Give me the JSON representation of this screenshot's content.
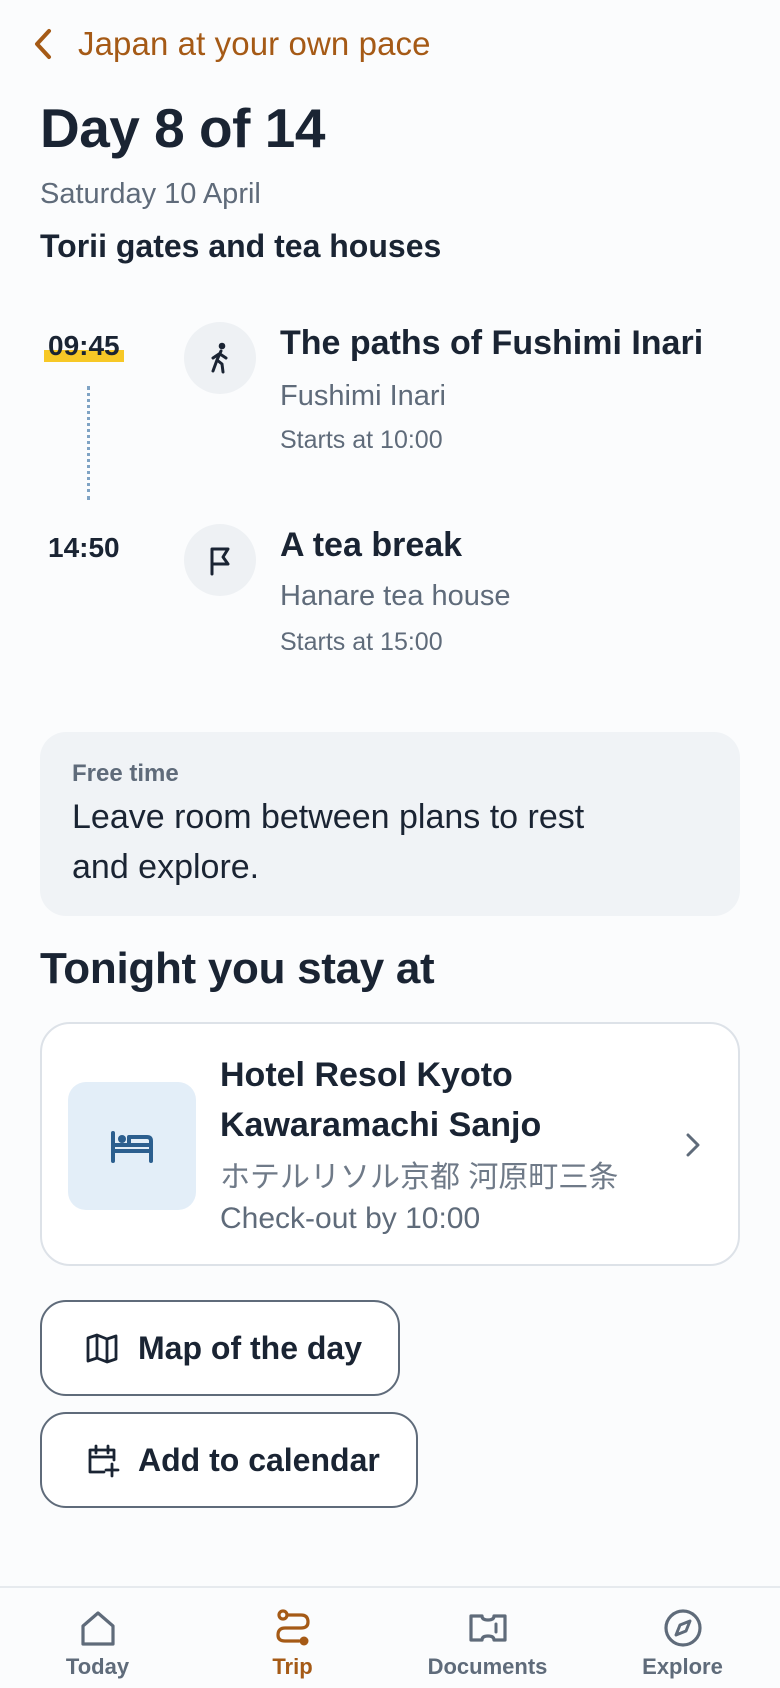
{
  "header": {
    "back_label": "Japan at your own pace",
    "day_title": "Day 8 of 14",
    "date": "Saturday 10 April",
    "theme": "Torii gates and tea houses"
  },
  "timeline": [
    {
      "time": "09:45",
      "icon": "walking-person-icon",
      "title": "The paths of Fushimi Inari",
      "place": "Fushimi Inari",
      "starts": "Starts at 10:00",
      "current": true
    },
    {
      "time": "14:50",
      "icon": "flag-icon",
      "title": "A tea break",
      "place": "Hanare tea house",
      "starts": "Starts at 15:00",
      "current": false
    }
  ],
  "note": {
    "label": "Free time",
    "text": "Leave room between plans to rest and explore."
  },
  "stay": {
    "heading": "Tonight you stay at",
    "hotel_name": "Hotel Resol Kyoto Kawaramachi Sanjo",
    "hotel_local_name": "ホテルリソル京都 河原町三条",
    "checkout": "Check-out by 10:00",
    "icon": "bed-icon"
  },
  "actions": {
    "map_label": "Map of the day",
    "calendar_label": "Add to calendar"
  },
  "tabs": [
    {
      "label": "Today",
      "icon": "home-icon",
      "active": false
    },
    {
      "label": "Trip",
      "icon": "route-icon",
      "active": true
    },
    {
      "label": "Documents",
      "icon": "ticket-icon",
      "active": false
    },
    {
      "label": "Explore",
      "icon": "compass-icon",
      "active": false
    }
  ],
  "colors": {
    "accent": "#a55a16",
    "highlight": "#f7c826",
    "text": "#1a2433",
    "muted": "#5f6b7a"
  }
}
